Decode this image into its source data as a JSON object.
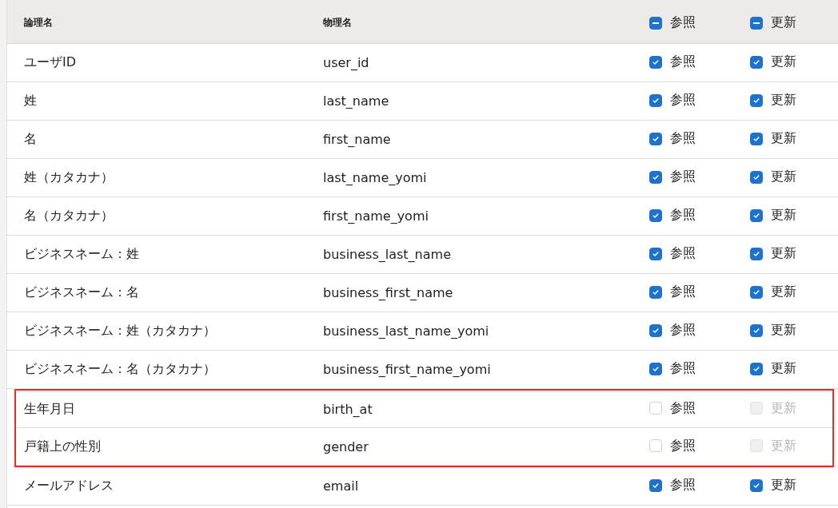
{
  "header": {
    "logical": "論理名",
    "physical": "物理名",
    "read": {
      "label": "参照",
      "indeterminate": true
    },
    "update": {
      "label": "更新",
      "indeterminate": true
    }
  },
  "rows": [
    {
      "logical": "ユーザID",
      "physical": "user_id",
      "highlighted": false,
      "read": {
        "label": "参照",
        "checked": true,
        "disabled": false
      },
      "update": {
        "label": "更新",
        "checked": true,
        "disabled": false
      }
    },
    {
      "logical": "姓",
      "physical": "last_name",
      "highlighted": false,
      "read": {
        "label": "参照",
        "checked": true,
        "disabled": false
      },
      "update": {
        "label": "更新",
        "checked": true,
        "disabled": false
      }
    },
    {
      "logical": "名",
      "physical": "first_name",
      "highlighted": false,
      "read": {
        "label": "参照",
        "checked": true,
        "disabled": false
      },
      "update": {
        "label": "更新",
        "checked": true,
        "disabled": false
      }
    },
    {
      "logical": "姓（カタカナ）",
      "physical": "last_name_yomi",
      "highlighted": false,
      "read": {
        "label": "参照",
        "checked": true,
        "disabled": false
      },
      "update": {
        "label": "更新",
        "checked": true,
        "disabled": false
      }
    },
    {
      "logical": "名（カタカナ）",
      "physical": "first_name_yomi",
      "highlighted": false,
      "read": {
        "label": "参照",
        "checked": true,
        "disabled": false
      },
      "update": {
        "label": "更新",
        "checked": true,
        "disabled": false
      }
    },
    {
      "logical": "ビジネスネーム：姓",
      "physical": "business_last_name",
      "highlighted": false,
      "read": {
        "label": "参照",
        "checked": true,
        "disabled": false
      },
      "update": {
        "label": "更新",
        "checked": true,
        "disabled": false
      }
    },
    {
      "logical": "ビジネスネーム：名",
      "physical": "business_first_name",
      "highlighted": false,
      "read": {
        "label": "参照",
        "checked": true,
        "disabled": false
      },
      "update": {
        "label": "更新",
        "checked": true,
        "disabled": false
      }
    },
    {
      "logical": "ビジネスネーム：姓（カタカナ）",
      "physical": "business_last_name_yomi",
      "highlighted": false,
      "read": {
        "label": "参照",
        "checked": true,
        "disabled": false
      },
      "update": {
        "label": "更新",
        "checked": true,
        "disabled": false
      }
    },
    {
      "logical": "ビジネスネーム：名（カタカナ）",
      "physical": "business_first_name_yomi",
      "highlighted": false,
      "read": {
        "label": "参照",
        "checked": true,
        "disabled": false
      },
      "update": {
        "label": "更新",
        "checked": true,
        "disabled": false
      }
    },
    {
      "logical": "生年月日",
      "physical": "birth_at",
      "highlighted": true,
      "read": {
        "label": "参照",
        "checked": false,
        "disabled": false
      },
      "update": {
        "label": "更新",
        "checked": false,
        "disabled": true
      }
    },
    {
      "logical": "戸籍上の性別",
      "physical": "gender",
      "highlighted": true,
      "read": {
        "label": "参照",
        "checked": false,
        "disabled": false
      },
      "update": {
        "label": "更新",
        "checked": false,
        "disabled": true
      }
    },
    {
      "logical": "メールアドレス",
      "physical": "email",
      "highlighted": false,
      "read": {
        "label": "参照",
        "checked": true,
        "disabled": false
      },
      "update": {
        "label": "更新",
        "checked": true,
        "disabled": false
      }
    }
  ]
}
